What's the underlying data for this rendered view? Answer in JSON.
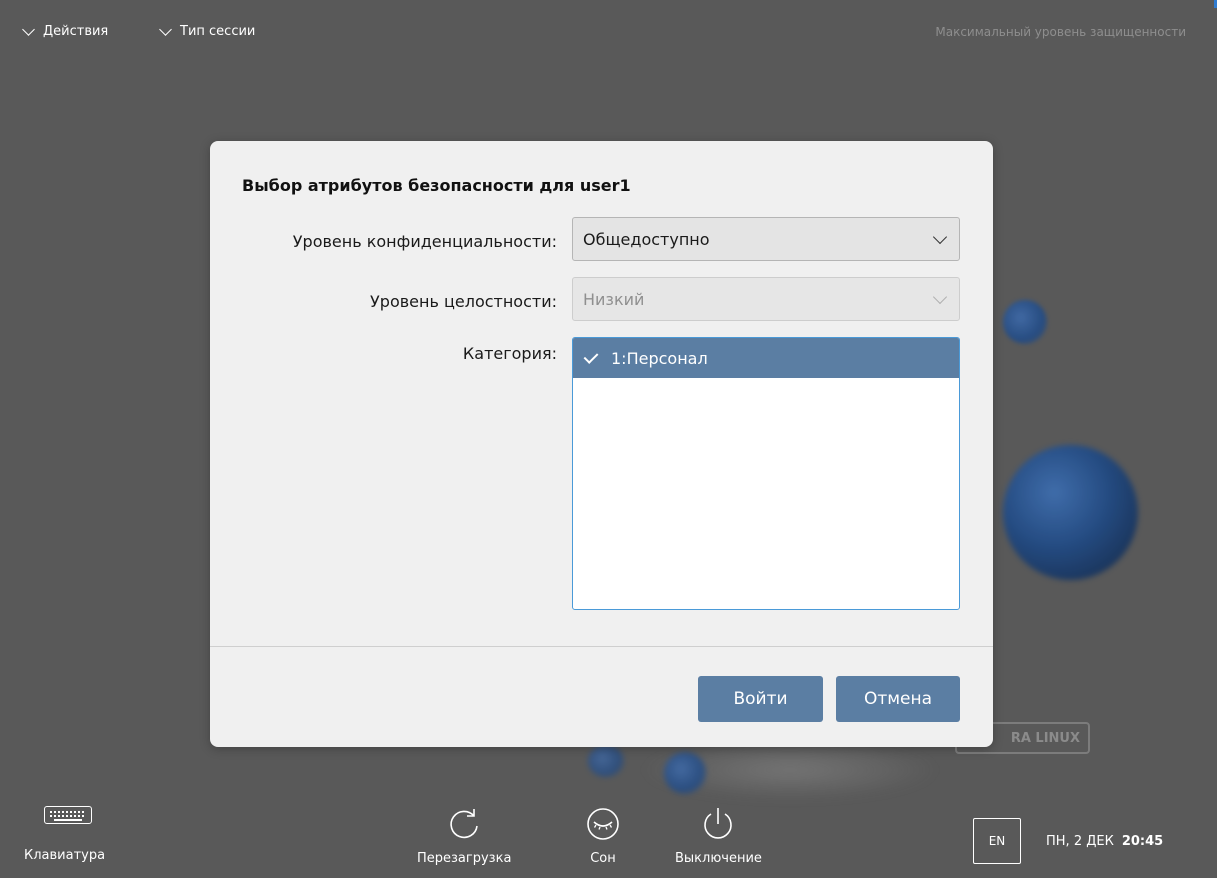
{
  "top_bar": {
    "actions_label": "Действия",
    "session_type_label": "Тип сессии",
    "security_level_text": "Максимальный уровень защищенности"
  },
  "dialog": {
    "title": "Выбор атрибутов безопасности для user1",
    "confidentiality": {
      "label": "Уровень конфиденциальности:",
      "value": "Общедоступно"
    },
    "integrity": {
      "label": "Уровень целостности:",
      "value": "Низкий",
      "disabled": true
    },
    "category": {
      "label": "Категория:",
      "items": [
        {
          "label": "1:Персонал",
          "checked": true
        }
      ]
    },
    "buttons": {
      "login": "Войти",
      "cancel": "Отмена"
    }
  },
  "bottom_bar": {
    "keyboard_label": "Клавиатура",
    "reboot_label": "Перезагрузка",
    "sleep_label": "Сон",
    "shutdown_label": "Выключение",
    "language": "EN",
    "date": "ПН, 2 ДЕК",
    "time": "20:45"
  },
  "background": {
    "logo_text": "RA LINUX"
  },
  "colors": {
    "background": "#595959",
    "accent": "#5b7ea3",
    "focus_border": "#4a9ad8",
    "dialog_bg": "#f0f0f0"
  },
  "icons": [
    "chevron-down-icon",
    "keyboard-icon",
    "reboot-icon",
    "sleep-icon",
    "power-icon",
    "checkmark-icon"
  ]
}
